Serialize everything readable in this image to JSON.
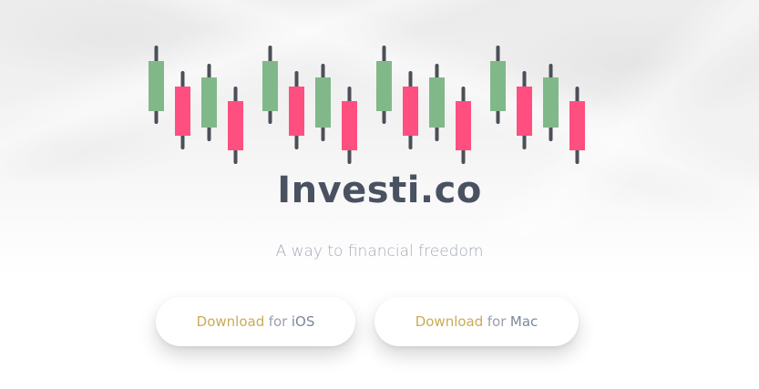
{
  "brand": {
    "name": "Investi.co",
    "tagline": "A way to financial freedom"
  },
  "colors": {
    "candle_up": "#81b88a",
    "candle_down": "#ff4f80",
    "wick": "#4b4f57",
    "title": "#4a5261",
    "tagline": "#a3aab6",
    "button_word_download": "#c9ac55",
    "button_word_for": "#9aa0ab",
    "button_word_platform": "#7d8799"
  },
  "logo": {
    "icon": "candlestick-chart-logo",
    "candles": [
      {
        "direction": "up"
      },
      {
        "direction": "down"
      },
      {
        "direction": "up"
      },
      {
        "direction": "down"
      },
      {
        "direction": "up"
      },
      {
        "direction": "down"
      },
      {
        "direction": "up"
      },
      {
        "direction": "down"
      },
      {
        "direction": "up"
      },
      {
        "direction": "down"
      },
      {
        "direction": "up"
      },
      {
        "direction": "down"
      },
      {
        "direction": "up"
      },
      {
        "direction": "down"
      },
      {
        "direction": "up"
      },
      {
        "direction": "down"
      }
    ]
  },
  "buttons": {
    "ios": {
      "word1": "Download",
      "word2": "for",
      "word3": "iOS"
    },
    "mac": {
      "word1": "Download",
      "word2": "for",
      "word3": "Mac"
    }
  }
}
